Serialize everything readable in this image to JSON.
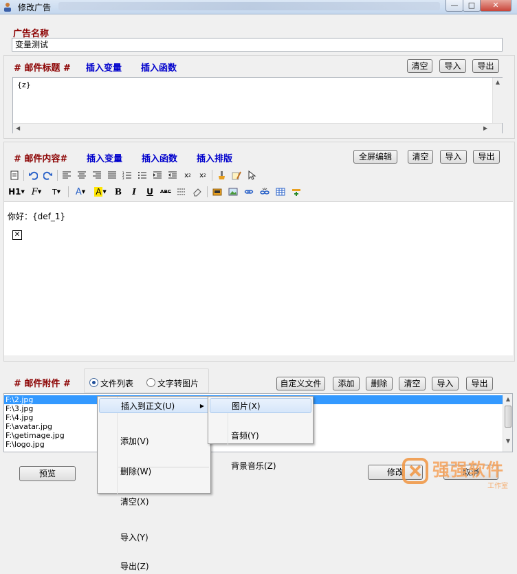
{
  "window": {
    "title": "修改广告"
  },
  "ad_name": {
    "label": "广告名称",
    "value": "变量测试"
  },
  "subject": {
    "label": "# 邮件标题 #",
    "insert_var": "插入变量",
    "insert_func": "插入函数",
    "clear": "清空",
    "import": "导入",
    "export": "导出",
    "value": "{z}"
  },
  "content": {
    "label": "# 邮件内容#",
    "insert_var": "插入变量",
    "insert_func": "插入函数",
    "insert_layout": "插入排版",
    "fullscreen": "全屏编辑",
    "clear": "清空",
    "import": "导入",
    "export": "导出",
    "toolbar": {
      "h1": "H1",
      "font": "F",
      "size": "T",
      "fg": "A",
      "bg": "A",
      "bold": "B",
      "italic": "I",
      "underline": "U",
      "strike": "ABC",
      "sub": "x",
      "sup": "x"
    },
    "body_text": "你好：{def_1}"
  },
  "attachments": {
    "label": "# 邮件附件 #",
    "mode_list": "文件列表",
    "mode_text_img": "文字转图片",
    "custom_file": "自定义文件",
    "add": "添加",
    "delete": "删除",
    "clear": "清空",
    "import": "导入",
    "export": "导出",
    "files": [
      "F:\\2.jpg",
      "F:\\3.jpg",
      "F:\\4.jpg",
      "F:\\avatar.jpg",
      "F:\\getimage.jpg",
      "F:\\logo.jpg"
    ]
  },
  "context_menu": {
    "insert_body": "插入到正文(U)",
    "add": "添加(V)",
    "delete": "删除(W)",
    "clear": "清空(X)",
    "import": "导入(Y)",
    "export": "导出(Z)"
  },
  "submenu": {
    "image": "图片(X)",
    "audio": "音频(Y)",
    "bgm": "背景音乐(Z)"
  },
  "footer": {
    "preview": "预览",
    "modify": "修改",
    "cancel": "取消"
  },
  "watermark": {
    "text": "强强软件",
    "sub": "工作室"
  },
  "colors": {
    "label_red": "#8b0000",
    "label_blue": "#0000cc",
    "selection": "#3399ff"
  }
}
